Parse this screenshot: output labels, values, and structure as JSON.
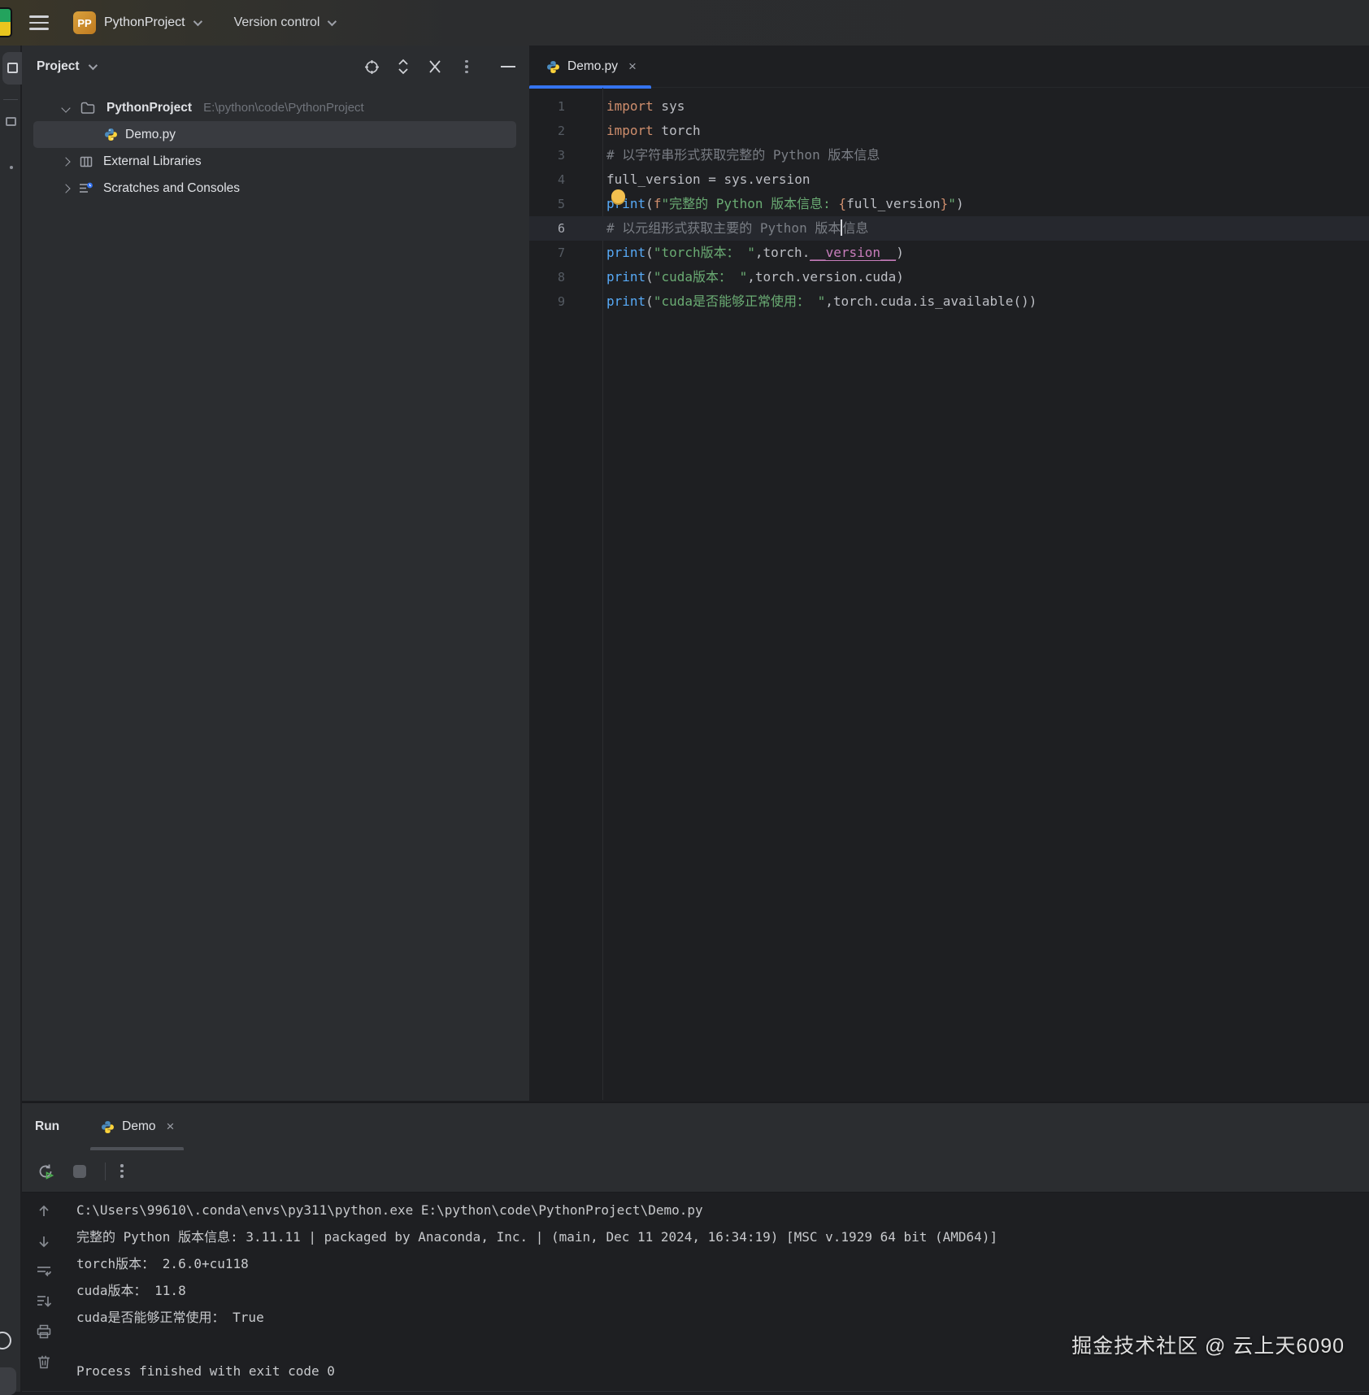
{
  "topbar": {
    "project_badge": "PP",
    "project_name": "PythonProject",
    "version_control_label": "Version control"
  },
  "project_panel": {
    "title": "Project",
    "root_name": "PythonProject",
    "root_path": "E:\\python\\code\\PythonProject",
    "file_name": "Demo.py",
    "external_libraries_label": "External Libraries",
    "scratches_label": "Scratches and Consoles"
  },
  "editor": {
    "tab_label": "Demo.py",
    "close_glyph": "×",
    "lines": [
      {
        "num": "1",
        "segments": [
          [
            "import",
            "kw"
          ],
          [
            " sys",
            "plain"
          ]
        ]
      },
      {
        "num": "2",
        "segments": [
          [
            "import",
            "kw"
          ],
          [
            " torch",
            "plain"
          ]
        ]
      },
      {
        "num": "3",
        "segments": [
          [
            "# 以字符串形式获取完整的 Python 版本信息",
            "comment"
          ]
        ]
      },
      {
        "num": "4",
        "segments": [
          [
            "full_version = sys.version",
            "plain"
          ]
        ]
      },
      {
        "num": "5",
        "segments": [
          [
            "print",
            "func"
          ],
          [
            "(",
            "plain"
          ],
          [
            "f",
            "kw"
          ],
          [
            "\"完整的 Python 版本信息: ",
            "str"
          ],
          [
            "{",
            "brace"
          ],
          [
            "full_version",
            "plain"
          ],
          [
            "}",
            "brace"
          ],
          [
            "\"",
            "str"
          ],
          [
            ")",
            "plain"
          ]
        ]
      },
      {
        "num": "6",
        "current": true,
        "segments": [
          [
            "# 以元组形式获取主要的 Python 版本",
            "comment"
          ],
          [
            "",
            "cursor"
          ],
          [
            "信息",
            "comment"
          ]
        ]
      },
      {
        "num": "7",
        "segments": [
          [
            "print",
            "func"
          ],
          [
            "(",
            "plain"
          ],
          [
            "\"torch版本： \"",
            "str"
          ],
          [
            ",torch.",
            "plain"
          ],
          [
            "__version__",
            "dunder"
          ],
          [
            ")",
            "plain"
          ]
        ]
      },
      {
        "num": "8",
        "segments": [
          [
            "print",
            "func"
          ],
          [
            "(",
            "plain"
          ],
          [
            "\"cuda版本： \"",
            "str"
          ],
          [
            ",torch.version.cuda)",
            "plain"
          ]
        ]
      },
      {
        "num": "9",
        "segments": [
          [
            "print",
            "func"
          ],
          [
            "(",
            "plain"
          ],
          [
            "\"cuda是否能够正常使用： \"",
            "str"
          ],
          [
            ",torch.cuda.is_available())",
            "plain"
          ]
        ]
      }
    ]
  },
  "run_panel": {
    "label": "Run",
    "tab_label": "Demo",
    "close_glyph": "×",
    "console_lines": [
      "C:\\Users\\99610\\.conda\\envs\\py311\\python.exe E:\\python\\code\\PythonProject\\Demo.py",
      "完整的 Python 版本信息: 3.11.11 | packaged by Anaconda, Inc. | (main, Dec 11 2024, 16:34:19) [MSC v.1929 64 bit (AMD64)]",
      "torch版本： 2.6.0+cu118",
      "cuda版本： 11.8",
      "cuda是否能够正常使用： True",
      "",
      "Process finished with exit code 0"
    ]
  },
  "watermark": "掘金技术社区 @ 云上天6090",
  "colors": {
    "accent_blue": "#3574f0",
    "keyword_orange": "#cf8e6d",
    "string_green": "#6aab73",
    "comment_gray": "#7a7e85",
    "builtin_blue": "#57aaf7",
    "dunder_purple": "#c77dbb",
    "panel_bg": "#2b2d30",
    "editor_bg": "#1e1f22",
    "selection_bg": "#393b40"
  }
}
